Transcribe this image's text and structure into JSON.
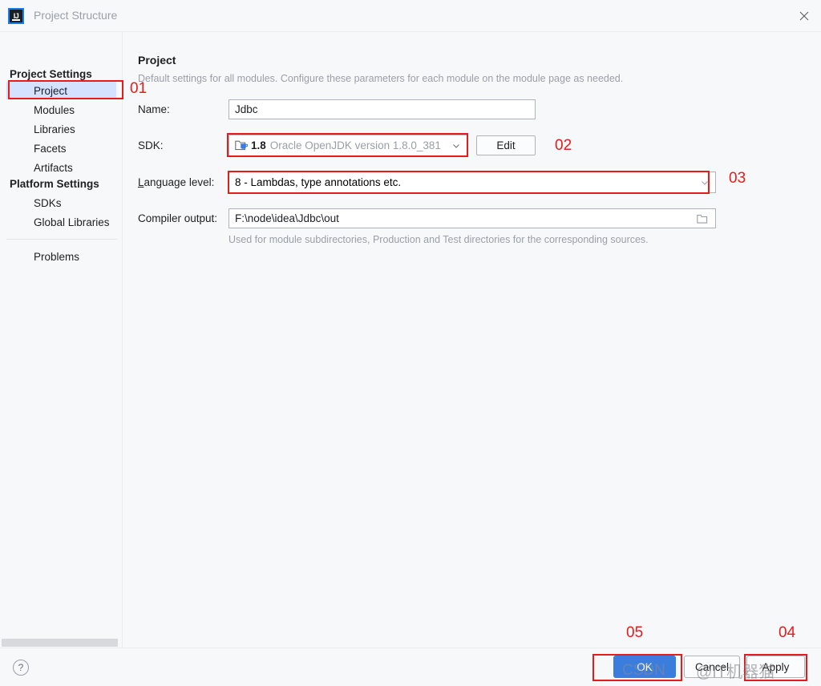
{
  "window": {
    "title": "Project Structure",
    "logo_text": "IJ",
    "close_icon": "close-icon"
  },
  "nav": {
    "back_icon": "arrow-left-icon",
    "forward_icon": "arrow-right-icon"
  },
  "sidebar": {
    "groups": [
      {
        "label": "Project Settings"
      },
      {
        "label": "Platform Settings"
      }
    ],
    "items": [
      {
        "label": "Project",
        "selected": true
      },
      {
        "label": "Modules",
        "selected": false
      },
      {
        "label": "Libraries",
        "selected": false
      },
      {
        "label": "Facets",
        "selected": false
      },
      {
        "label": "Artifacts",
        "selected": false
      },
      {
        "label": "SDKs",
        "selected": false
      },
      {
        "label": "Global Libraries",
        "selected": false
      },
      {
        "label": "Problems",
        "selected": false
      }
    ]
  },
  "main": {
    "title": "Project",
    "subtitle": "Default settings for all modules. Configure these parameters for each module on the module page as needed.",
    "name": {
      "label": "Name:",
      "value": "Jdbc"
    },
    "sdk": {
      "label": "SDK:",
      "version": "1.8",
      "description": "Oracle OpenJDK version 1.8.0_381",
      "icon": "java-sdk-icon",
      "dropdown_icon": "chevron-down-icon",
      "edit_label": "Edit"
    },
    "language_level": {
      "label": "Language level:",
      "value": "8 - Lambdas, type annotations etc.",
      "dropdown_icon": "chevron-down-icon"
    },
    "compiler_output": {
      "label": "Compiler output:",
      "value": "F:\\node\\idea\\Jdbc\\out",
      "browse_icon": "folder-icon",
      "hint": "Used for module subdirectories, Production and Test directories for the corresponding sources."
    }
  },
  "footer": {
    "help_label": "?",
    "ok_label": "OK",
    "cancel_label": "Cancel",
    "apply_label": "Apply"
  },
  "annotations": [
    {
      "number": "01"
    },
    {
      "number": "02"
    },
    {
      "number": "03"
    },
    {
      "number": "04"
    },
    {
      "number": "05"
    }
  ],
  "watermark": {
    "csdn": "CSDN",
    "author": "@IT机器猫"
  },
  "colors": {
    "accent": "#3b7ddd",
    "annotation": "#e81b1b",
    "selection": "#d4e2ff",
    "background": "#f7f8fa"
  }
}
